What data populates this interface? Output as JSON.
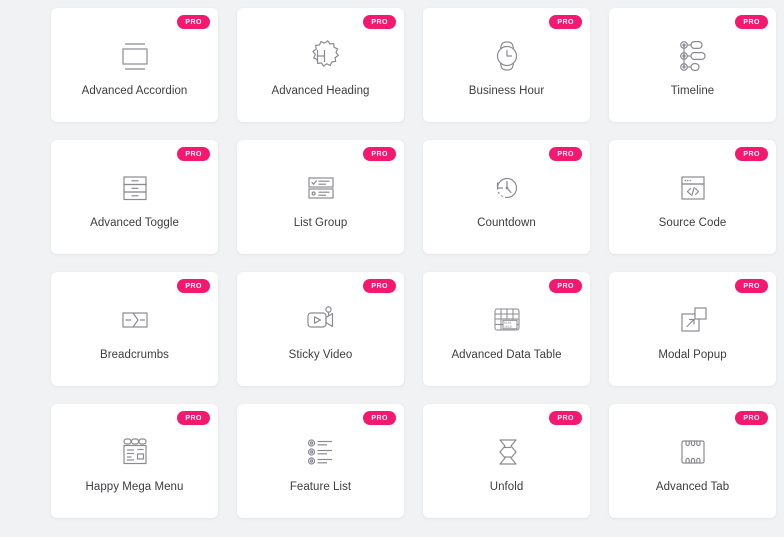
{
  "page": {
    "background_color": "#f1f2f3",
    "card_background": "#ffffff",
    "badge_color": "#f5186f",
    "label_color": "#3d3d42",
    "icon_stroke_color": "#8a8a92"
  },
  "badge": {
    "label": "PRO"
  },
  "widgets": [
    {
      "label": "Advanced Accordion",
      "icon": "accordion-panel-icon",
      "badge": "PRO"
    },
    {
      "label": "Advanced Heading",
      "icon": "gear-heading-h-icon",
      "badge": "PRO"
    },
    {
      "label": "Business Hour",
      "icon": "wristwatch-clock-icon",
      "badge": "PRO"
    },
    {
      "label": "Timeline",
      "icon": "timeline-nodes-icon",
      "badge": "PRO"
    },
    {
      "label": "Advanced Toggle",
      "icon": "stacked-toggle-rows-icon",
      "badge": "PRO"
    },
    {
      "label": "List Group",
      "icon": "checklist-rows-icon",
      "badge": "PRO"
    },
    {
      "label": "Countdown",
      "icon": "clock-rewind-icon",
      "badge": "PRO"
    },
    {
      "label": "Source Code",
      "icon": "code-window-icon",
      "badge": "PRO"
    },
    {
      "label": "Breadcrumbs",
      "icon": "breadcrumb-chevron-icon",
      "badge": "PRO"
    },
    {
      "label": "Sticky Video",
      "icon": "video-camera-pin-icon",
      "badge": "PRO"
    },
    {
      "label": "Advanced Data Table",
      "icon": "data-table-grid-icon",
      "badge": "PRO"
    },
    {
      "label": "Modal Popup",
      "icon": "popup-window-arrow-icon",
      "badge": "PRO"
    },
    {
      "label": "Happy Mega Menu",
      "icon": "mega-menu-panel-icon",
      "badge": "PRO"
    },
    {
      "label": "Feature List",
      "icon": "feature-list-bullets-icon",
      "badge": "PRO"
    },
    {
      "label": "Unfold",
      "icon": "unfold-zigzag-icon",
      "badge": "PRO"
    },
    {
      "label": "Advanced Tab",
      "icon": "tabs-panel-icon",
      "badge": "PRO"
    }
  ]
}
